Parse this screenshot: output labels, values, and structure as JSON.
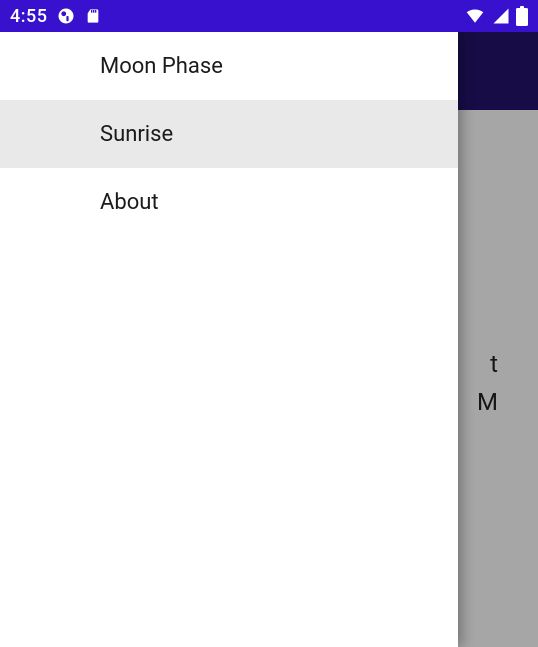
{
  "status": {
    "time": "4:55"
  },
  "drawer": {
    "items": [
      {
        "label": "Moon Phase",
        "selected": false
      },
      {
        "label": "Sunrise",
        "selected": true
      },
      {
        "label": "About",
        "selected": false
      }
    ]
  },
  "content": {
    "card_title_fragment": "t",
    "card_time_fragment": "M"
  }
}
